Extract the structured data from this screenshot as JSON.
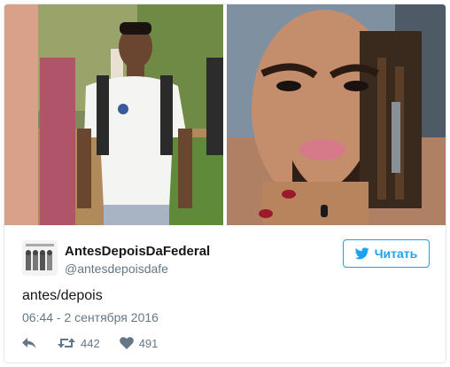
{
  "tweet": {
    "display_name": "AntesDepoisDaFederal",
    "handle": "@antesdepoisdafe",
    "text": "antes/depois",
    "timestamp": "06:44 - 2 сентября 2016",
    "follow_label": "Читать",
    "retweet_count": "442",
    "like_count": "491"
  },
  "colors": {
    "accent": "#1da1f2",
    "muted": "#657786",
    "text": "#14171a",
    "border": "#e1e8ed"
  },
  "icons": {
    "follow": "bird-icon",
    "reply": "reply-icon",
    "retweet": "retweet-icon",
    "like": "heart-icon"
  }
}
